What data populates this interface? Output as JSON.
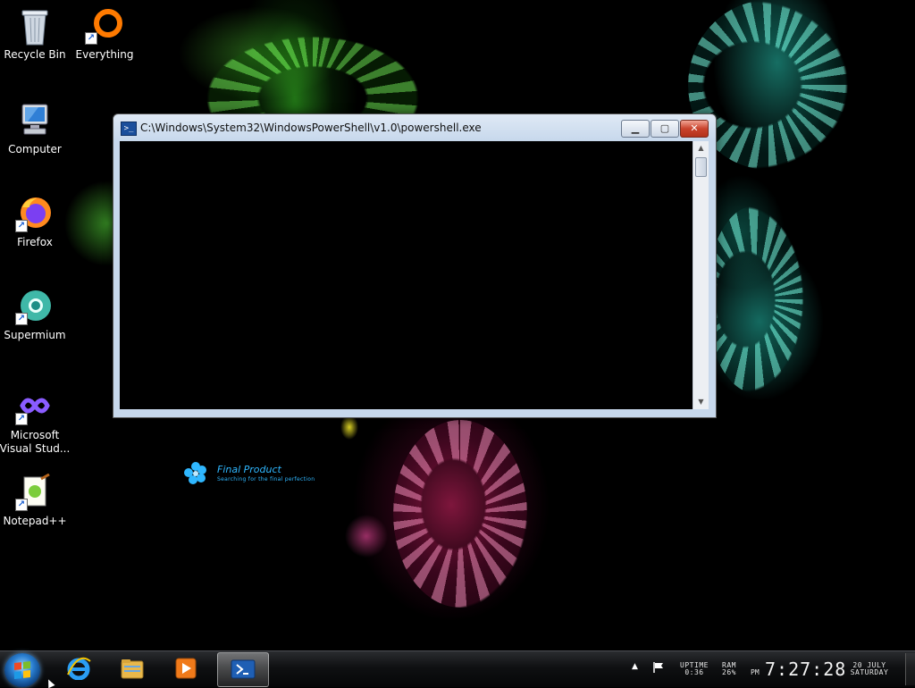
{
  "desktop": {
    "icons": [
      {
        "name": "recycle-bin",
        "label": "Recycle Bin",
        "icon": "recycle-bin-icon",
        "shortcut": false
      },
      {
        "name": "everything",
        "label": "Everything",
        "icon": "everything-search-icon",
        "shortcut": true
      },
      {
        "name": "computer",
        "label": "Computer",
        "icon": "computer-icon",
        "shortcut": false
      },
      {
        "name": "firefox",
        "label": "Firefox",
        "icon": "firefox-icon",
        "shortcut": true
      },
      {
        "name": "supermium",
        "label": "Supermium",
        "icon": "supermium-icon",
        "shortcut": true
      },
      {
        "name": "visual-studio",
        "label": "Microsoft Visual Stud...",
        "icon": "visual-studio-icon",
        "shortcut": true
      },
      {
        "name": "notepadpp",
        "label": "Notepad++",
        "icon": "notepadpp-icon",
        "shortcut": true
      }
    ],
    "wallpaper": {
      "brand_title": "Final Product",
      "brand_subtitle": "Searching for the final perfection"
    }
  },
  "window": {
    "title": "C:\\Windows\\System32\\WindowsPowerShell\\v1.0\\powershell.exe",
    "icon": "powershell-icon",
    "controls": {
      "minimize": "minimize-icon",
      "maximize": "maximize-icon",
      "close": "close-icon"
    },
    "console_background": "#000000"
  },
  "taskbar": {
    "start": "windows-start-orb-icon",
    "pinned": [
      {
        "name": "internet-explorer",
        "icon": "internet-explorer-icon",
        "active": false
      },
      {
        "name": "file-explorer",
        "icon": "folder-icon",
        "active": false
      },
      {
        "name": "media-player",
        "icon": "media-player-icon",
        "active": false
      },
      {
        "name": "powershell",
        "icon": "powershell-icon",
        "active": true
      }
    ],
    "tray": {
      "show_hidden": "▲",
      "action_center": "flag-icon",
      "uptime_label": "UPTIME",
      "uptime_value": "0:36",
      "ram_label": "RAM",
      "ram_value": "26%",
      "ampm": "PM",
      "time": "7:27:28",
      "date": "20 JULY",
      "day": "SATURDAY"
    }
  },
  "colors": {
    "taskbar_bg": "#0f1012",
    "title_text": "#111111",
    "accent_blue": "#2fb7ff",
    "close_red": "#c9432c"
  }
}
